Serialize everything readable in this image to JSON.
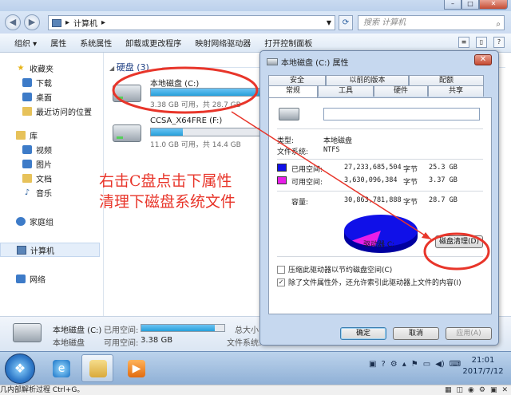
{
  "explorer": {
    "address": {
      "root_sep": "▸",
      "path": "计算机",
      "path_sep": "▸"
    },
    "search_placeholder": "搜索 计算机",
    "toolbar": [
      "组织 ▾",
      "属性",
      "系统属性",
      "卸载或更改程序",
      "映射网络驱动器",
      "打开控制面板"
    ],
    "nav": [
      {
        "label": "收藏夹",
        "icon": "star-icon",
        "glyph": "★"
      },
      {
        "label": "下载",
        "icon": "download-folder-icon",
        "glyph": ""
      },
      {
        "label": "桌面",
        "icon": "desktop-icon",
        "glyph": ""
      },
      {
        "label": "最近访问的位置",
        "icon": "recent-places-icon",
        "glyph": ""
      },
      {
        "label": "库",
        "icon": "library-icon",
        "glyph": ""
      },
      {
        "label": "视频",
        "icon": "video-icon",
        "glyph": ""
      },
      {
        "label": "图片",
        "icon": "pictures-icon",
        "glyph": ""
      },
      {
        "label": "文档",
        "icon": "documents-icon",
        "glyph": ""
      },
      {
        "label": "音乐",
        "icon": "music-icon",
        "glyph": "♪"
      },
      {
        "label": "家庭组",
        "icon": "homegroup-icon",
        "glyph": ""
      },
      {
        "label": "计算机",
        "icon": "computer-icon",
        "glyph": ""
      },
      {
        "label": "网络",
        "icon": "network-icon",
        "glyph": ""
      }
    ],
    "group_header": "硬盘 (3)",
    "drives": [
      {
        "name": "本地磁盘 (C:)",
        "used_fraction": 0.88,
        "sub": "3.38 GB 可用，共 28.7 GB"
      },
      {
        "name": "CCSA_X64FRE (F:)",
        "used_fraction": 0.23,
        "sub": "11.0 GB 可用，共 14.4 GB"
      }
    ],
    "details": {
      "name": "本地磁盘 (C:)",
      "type": "本地磁盘",
      "k_used": "已用空间:",
      "used_fraction": 0.88,
      "k_free": "可用空间:",
      "free": "3.38 GB",
      "k_total": "总大小:",
      "k_fs": "文件系统:"
    }
  },
  "dialog": {
    "title": "本地磁盘 (C:) 属性",
    "close": "✕",
    "tabs_top": [
      "安全",
      "以前的版本",
      "配额"
    ],
    "tabs_bottom": [
      "常规",
      "工具",
      "硬件",
      "共享"
    ],
    "type_label": "类型:",
    "type_value": "本地磁盘",
    "fs_label": "文件系统:",
    "fs_value": "NTFS",
    "used_label": "已用空间:",
    "used_bytes": "27,233,685,504",
    "used_unit": "字节",
    "used_gb": "25.3 GB",
    "free_label": "可用空间:",
    "free_bytes": "3,630,096,384",
    "free_unit": "字节",
    "free_gb": "3.37 GB",
    "cap_label": "容量:",
    "cap_bytes": "30,863,781,888",
    "cap_unit": "字节",
    "cap_gb": "28.7 GB",
    "drive_label": "驱动器 C:",
    "cleanup": "磁盘清理(D)",
    "compress": "压缩此驱动器以节约磁盘空间(C)",
    "index": "除了文件属性外，还允许索引此驱动器上文件的内容(I)",
    "ok": "确定",
    "cancel": "取消",
    "apply": "应用(A)",
    "colors": {
      "used": "#1010e8",
      "free": "#e81ee8"
    },
    "used_fraction": 0.882
  },
  "annotation": {
    "line1": "右击C盘点击下属性",
    "line2": "清理下磁盘系统文件",
    "color": "#e8352a"
  },
  "taskbar": {
    "time": "21:01",
    "date": "2017/7/12",
    "apps": [
      "ie-icon",
      "explorer-icon",
      "media-player-icon"
    ]
  },
  "statusbar": {
    "text": "几内部解析过程 Ctrl+G。"
  }
}
